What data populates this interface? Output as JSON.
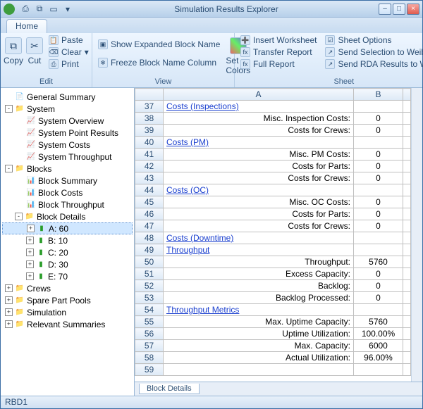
{
  "window": {
    "title": "Simulation Results Explorer"
  },
  "ribbon": {
    "tab": "Home",
    "edit": {
      "label": "Edit",
      "copy": "Copy",
      "cut": "Cut",
      "paste": "Paste",
      "clear": "Clear",
      "print": "Print"
    },
    "view": {
      "label": "View",
      "showExpanded": "Show Expanded Block Name",
      "setColors": "Set Colors",
      "freeze": "Freeze Block Name Column"
    },
    "sheet": {
      "label": "Sheet",
      "insert": "Insert Worksheet",
      "transfer": "Transfer Report",
      "full": "Full Report",
      "options": "Sheet Options",
      "sendWeibull": "Send Selection to Weibull++",
      "sendRDA": "Send RDA Results to Weibull"
    }
  },
  "tree": {
    "generalSummary": "General Summary",
    "system": "System",
    "systemOverview": "System Overview",
    "systemPoint": "System Point Results",
    "systemCosts": "System Costs",
    "systemThroughput": "System Throughput",
    "blocks": "Blocks",
    "blockSummary": "Block Summary",
    "blockCosts": "Block Costs",
    "blockThroughput": "Block Throughput",
    "blockDetails": "Block Details",
    "a60": "A: 60",
    "b10": "B: 10",
    "c20": "C: 20",
    "d30": "D: 30",
    "e70": "E: 70",
    "crews": "Crews",
    "spare": "Spare Part Pools",
    "simulation": "Simulation",
    "relevant": "Relevant Summaries"
  },
  "sheetTab": "Block Details",
  "status": "RBD1",
  "chart_data": {
    "type": "table",
    "columns": [
      "A",
      "B"
    ],
    "row_start": 37,
    "rows": [
      {
        "r": 37,
        "a": "Costs (Inspections)",
        "link": true,
        "b": ""
      },
      {
        "r": 38,
        "a": "Misc. Inspection Costs:",
        "b": "0"
      },
      {
        "r": 39,
        "a": "Costs for Crews:",
        "b": "0"
      },
      {
        "r": 40,
        "a": "Costs (PM)",
        "link": true,
        "b": ""
      },
      {
        "r": 41,
        "a": "Misc. PM Costs:",
        "b": "0"
      },
      {
        "r": 42,
        "a": "Costs for Parts:",
        "b": "0"
      },
      {
        "r": 43,
        "a": "Costs for Crews:",
        "b": "0"
      },
      {
        "r": 44,
        "a": "Costs (OC)",
        "link": true,
        "b": ""
      },
      {
        "r": 45,
        "a": "Misc. OC Costs:",
        "b": "0"
      },
      {
        "r": 46,
        "a": "Costs for Parts:",
        "b": "0"
      },
      {
        "r": 47,
        "a": "Costs for Crews:",
        "b": "0"
      },
      {
        "r": 48,
        "a": "Costs (Downtime)",
        "link": true,
        "b": ""
      },
      {
        "r": 49,
        "a": "Throughput",
        "link": true,
        "b": ""
      },
      {
        "r": 50,
        "a": "Throughput:",
        "b": "5760"
      },
      {
        "r": 51,
        "a": "Excess Capacity:",
        "b": "0"
      },
      {
        "r": 52,
        "a": "Backlog:",
        "b": "0"
      },
      {
        "r": 53,
        "a": "Backlog Processed:",
        "b": "0"
      },
      {
        "r": 54,
        "a": "Throughput Metrics",
        "link": true,
        "b": ""
      },
      {
        "r": 55,
        "a": "Max. Uptime Capacity:",
        "b": "5760"
      },
      {
        "r": 56,
        "a": "Uptime Utilization:",
        "b": "100.00%"
      },
      {
        "r": 57,
        "a": "Max. Capacity:",
        "b": "6000"
      },
      {
        "r": 58,
        "a": "Actual Utilization:",
        "b": "96.00%"
      },
      {
        "r": 59,
        "a": "",
        "b": ""
      }
    ]
  }
}
